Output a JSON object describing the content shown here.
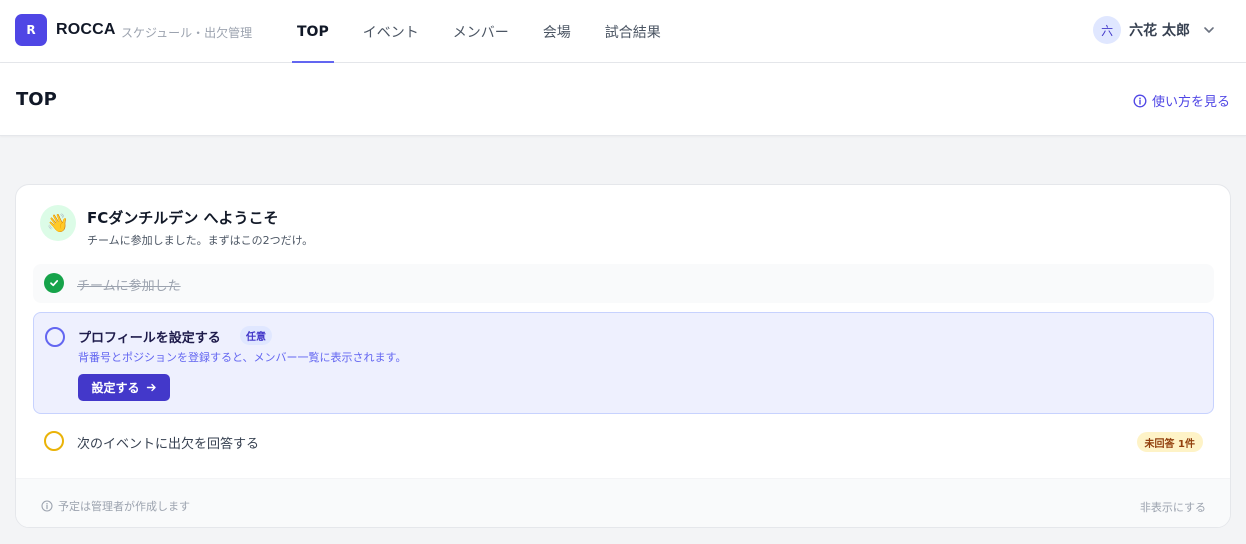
{
  "app": {
    "logo_letter": "R",
    "name": "ROCCA",
    "subtitle": "スケジュール・出欠管理"
  },
  "nav": {
    "items": [
      {
        "label": "TOP",
        "active": true
      },
      {
        "label": "イベント",
        "active": false
      },
      {
        "label": "メンバー",
        "active": false
      },
      {
        "label": "会場",
        "active": false
      },
      {
        "label": "試合結果",
        "active": false
      }
    ]
  },
  "user": {
    "avatar_letter": "六",
    "name": "六花 太郎",
    "menu_icon": "chevron-down-icon"
  },
  "page": {
    "title": "TOP",
    "help_link": "使い方を見る",
    "help_icon": "info-icon"
  },
  "welcome": {
    "icon": "waving-hand-icon",
    "emoji": "👋",
    "title": "FCダンチルデン へようこそ",
    "subtitle": "チームに参加しました。まずはこの2つだけ。"
  },
  "steps": [
    {
      "label": "チームに参加した",
      "status": "done"
    },
    {
      "label": "プロフィールを設定する",
      "tag": "任意",
      "description": "背番号とポジションを登録すると、メンバー一覧に表示されます。",
      "button": "設定する",
      "status": "active"
    },
    {
      "label": "次のイベントに出欠を回答する",
      "badge": "未回答 1件",
      "status": "todo"
    }
  ],
  "footer": {
    "note": "予定は管理者が作成します",
    "hide_link": "非表示にする"
  },
  "colors": {
    "accent": "#4f46e5",
    "success": "#16a34a",
    "warning": "#eab308",
    "active_bg": "#eef0fe"
  }
}
